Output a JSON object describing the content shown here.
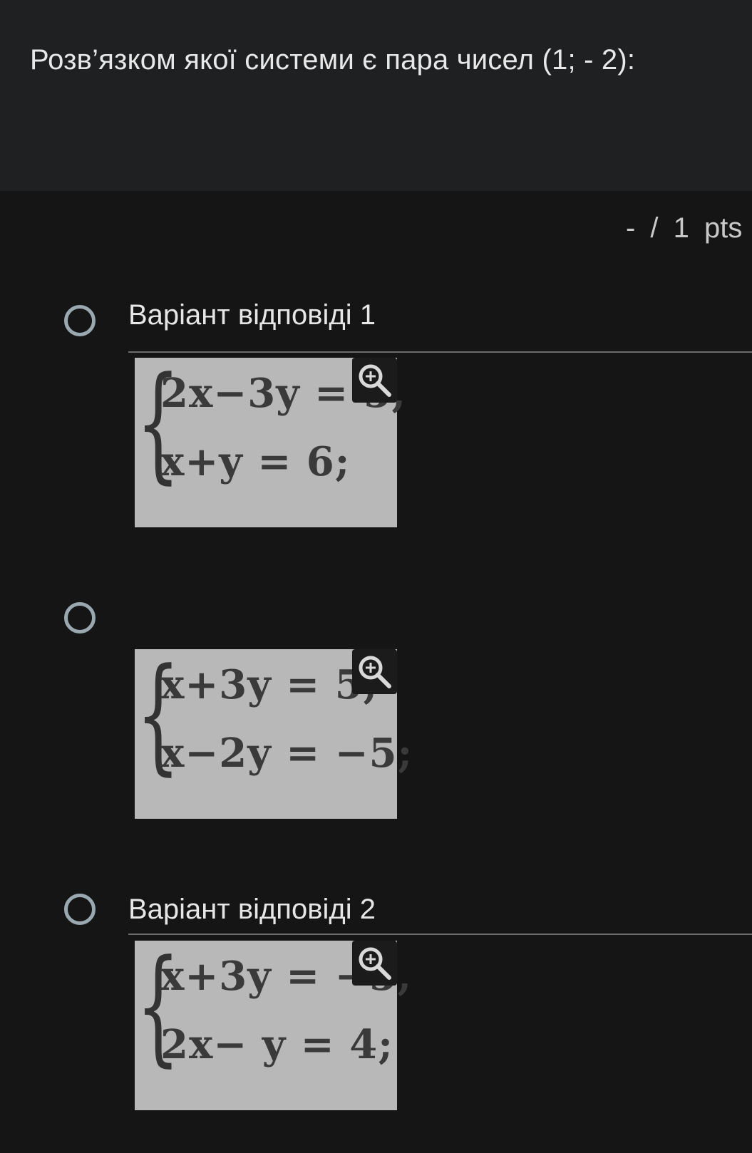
{
  "question": {
    "text": "Розв’язком якої системи є пара чисел (1; - 2):"
  },
  "points": {
    "text": "- / 1 pts"
  },
  "options": [
    {
      "label": "Варіант відповіді 1",
      "eq1": "2x−3y = 5,",
      "eq2": "x+y = 6;"
    },
    {
      "label": "",
      "eq1": "x+3y = 5,",
      "eq2": "x−2y = −5;"
    },
    {
      "label": "Варіант відповіді 2",
      "eq1": "x+3y = −5,",
      "eq2": "2x− y = 4;"
    }
  ],
  "icons": {
    "radio": "radio-unchecked-icon",
    "zoom": "zoom-in-icon"
  },
  "colors": {
    "background": "#151516",
    "header": "#1f2022",
    "formula_bg": "#b8b8b8",
    "radio": "#9aa9b0"
  }
}
